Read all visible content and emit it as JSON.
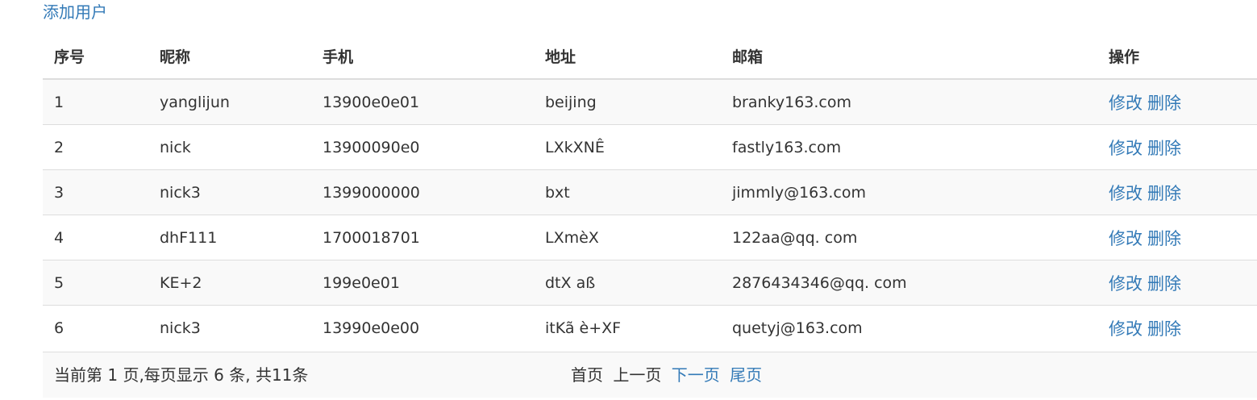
{
  "add_user_label": "添加用户",
  "table": {
    "headers": {
      "seq": "序号",
      "nickname": "昵称",
      "phone": "手机",
      "address": "地址",
      "email": "邮箱",
      "operations": "操作"
    },
    "rows": [
      {
        "seq": "1",
        "nickname": "yanglijun",
        "phone": "13900e0e01",
        "address": "beijing",
        "email": "branky163.com",
        "edit": "修改",
        "delete": "删除"
      },
      {
        "seq": "2",
        "nickname": "nick",
        "phone": "13900090e0",
        "address": "LXkXNÊ",
        "email": "fastly163.com",
        "edit": "修改",
        "delete": "删除"
      },
      {
        "seq": "3",
        "nickname": "nick3",
        "phone": "1399000000",
        "address": "bxt",
        "email": "jimmly@163.com",
        "edit": "修改",
        "delete": "删除"
      },
      {
        "seq": "4",
        "nickname": "dhF111",
        "phone": "1700018701",
        "address": "LXmèX",
        "email": "122aa@qq. com",
        "edit": "修改",
        "delete": "删除"
      },
      {
        "seq": "5",
        "nickname": "KE+2",
        "phone": "199e0e01",
        "address": "dtX aß",
        "email": "2876434346@qq. com",
        "edit": "修改",
        "delete": "删除"
      },
      {
        "seq": "6",
        "nickname": "nick3",
        "phone": "13990e0e00",
        "address": "itKã è+XF",
        "email": "quetyj@163.com",
        "edit": "修改",
        "delete": "删除"
      }
    ]
  },
  "pager": {
    "info": "当前第 1 页,每页显示 6 条, 共11条",
    "first": "首页",
    "prev": "上一页",
    "next": "下一页",
    "last": "尾页"
  },
  "colors": {
    "link": "#337ab7",
    "stripe": "#f9f9f9",
    "border": "#dddddd"
  }
}
